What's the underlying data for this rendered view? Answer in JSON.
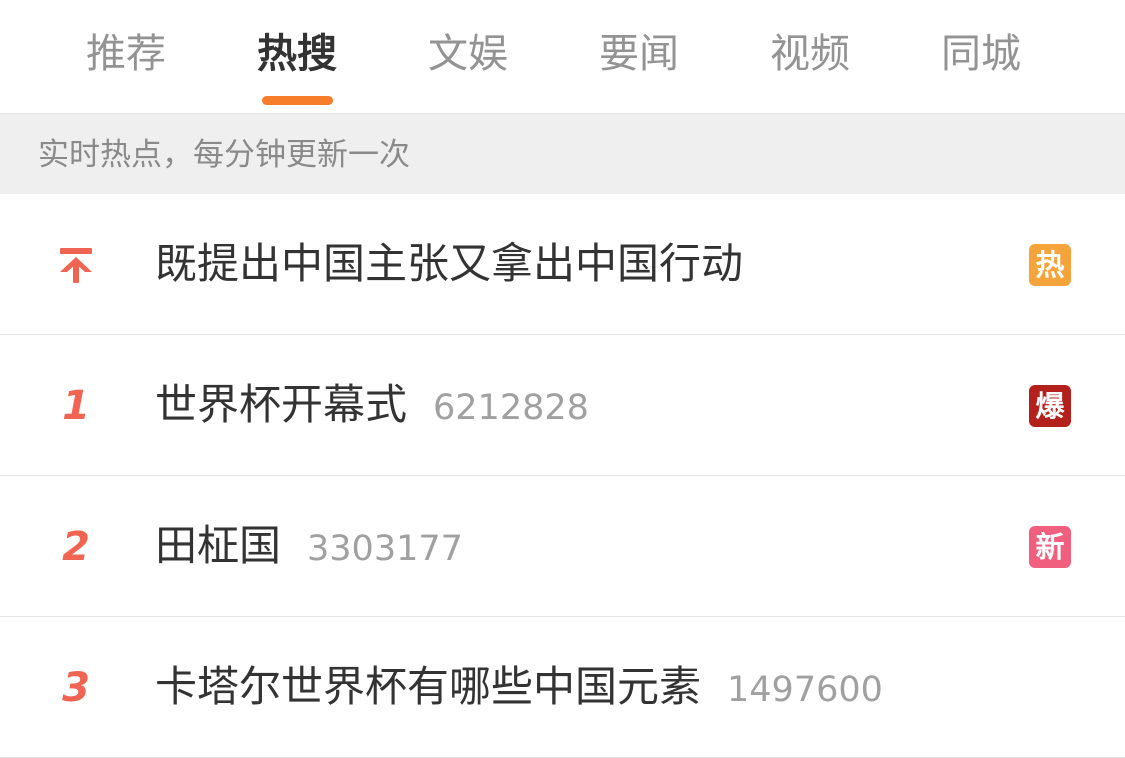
{
  "tabs": [
    {
      "label": "推荐",
      "active": false
    },
    {
      "label": "热搜",
      "active": true
    },
    {
      "label": "文娱",
      "active": false
    },
    {
      "label": "要闻",
      "active": false
    },
    {
      "label": "视频",
      "active": false
    },
    {
      "label": "同城",
      "active": false
    }
  ],
  "banner": {
    "text": "实时热点，每分钟更新一次"
  },
  "rows": [
    {
      "rank": "",
      "rank_icon": "arrow-up-to-top-icon",
      "title": "既提出中国主张又拿出中国行动",
      "count": "",
      "badge": "热",
      "badge_color": "#f5a33b"
    },
    {
      "rank": "1",
      "rank_icon": "",
      "title": "世界杯开幕式",
      "count": "6212828",
      "badge": "爆",
      "badge_color": "#b4211c"
    },
    {
      "rank": "2",
      "rank_icon": "",
      "title": "田柾国",
      "count": "3303177",
      "badge": "新",
      "badge_color": "#f0607e"
    },
    {
      "rank": "3",
      "rank_icon": "",
      "title": "卡塔尔世界杯有哪些中国元素",
      "count": "1497600",
      "badge": "",
      "badge_color": ""
    }
  ],
  "colors": {
    "accent": "#f87d2a",
    "rank": "#ef6552"
  }
}
